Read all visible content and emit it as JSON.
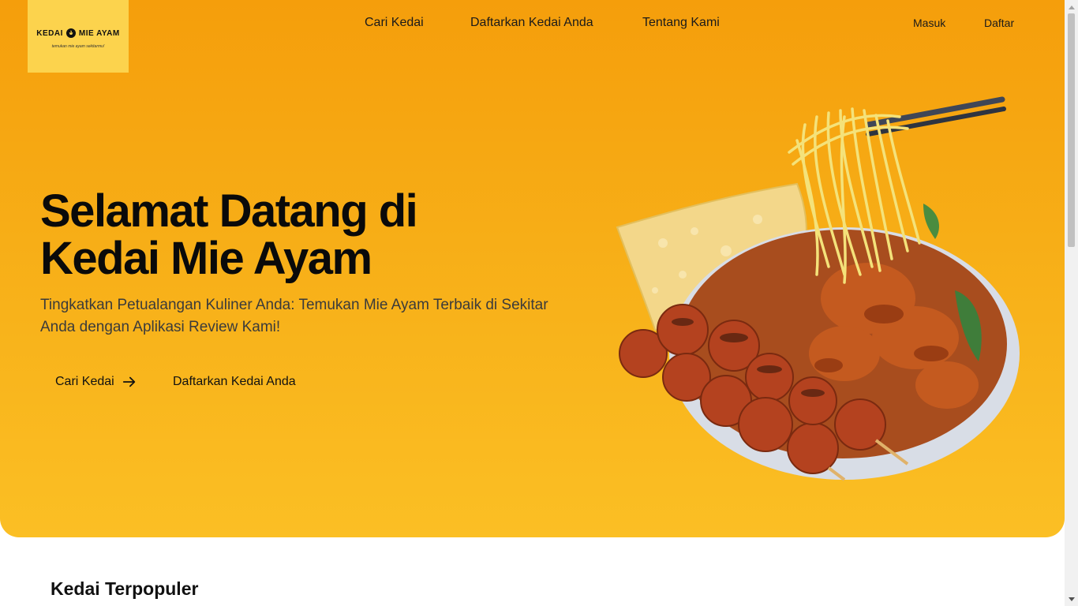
{
  "logo": {
    "title_left": "KEDAI",
    "title_right": "MIE AYAM",
    "tagline": "temukan mie ayam sekitarmu!"
  },
  "nav": {
    "links": [
      "Cari Kedai",
      "Daftarkan Kedai Anda",
      "Tentang Kami"
    ],
    "login": "Masuk",
    "register": "Daftar"
  },
  "hero": {
    "title": "Selamat Datang di Kedai Mie Ayam",
    "subtitle": "Tingkatkan Petualangan Kuliner Anda: Temukan Mie Ayam Terbaik di Sekitar Anda dengan Aplikasi Review Kami!",
    "primary_button": "Cari Kedai",
    "secondary_button": "Daftarkan Kedai Anda",
    "image_icon": "mie-ayam-bowl-image"
  },
  "popular": {
    "title": "Kedai Terpopuler",
    "subtitle": ""
  },
  "colors": {
    "hero_top": "#f59e0b",
    "hero_bottom": "#fbbf24",
    "logo_bg": "#fcd34d",
    "text": "#0a0a0a"
  }
}
